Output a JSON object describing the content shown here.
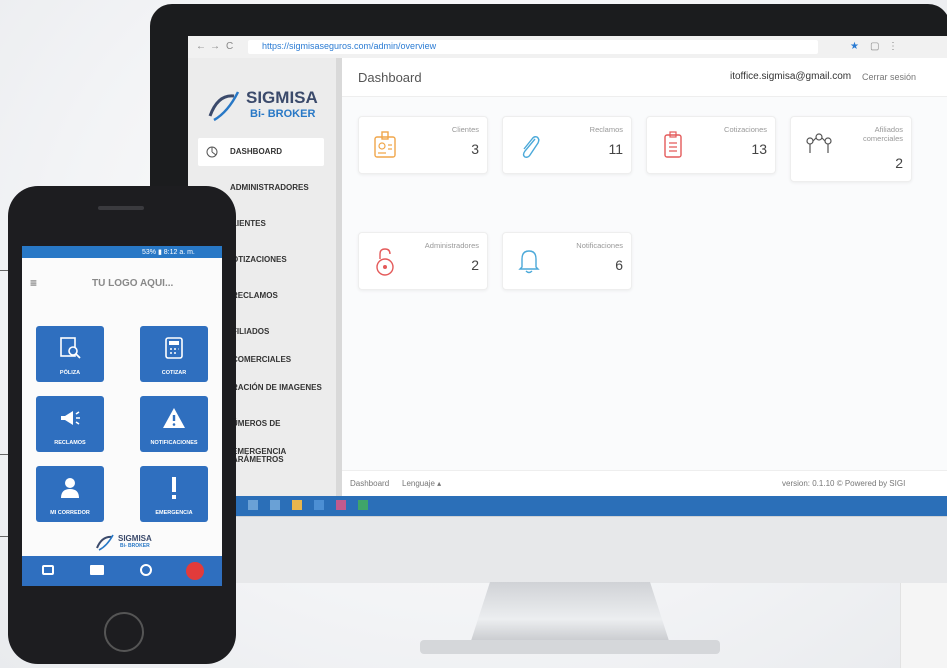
{
  "browser": {
    "url": "https://sigmisaseguros.com/admin/overview"
  },
  "brand": {
    "name": "SIGMISA",
    "tagline": "Bi- BROKER",
    "accent": "#2878c6"
  },
  "sidebar": {
    "items": [
      {
        "label": "DASHBOARD",
        "icon": "pie-chart-icon"
      },
      {
        "label": "ADMINISTRADORES"
      },
      {
        "label": "LIENTES"
      },
      {
        "label": "OTIZACIONES"
      },
      {
        "label": "RECLAMOS"
      },
      {
        "label": "FILIADOS COMERCIALES"
      },
      {
        "label": "RACIÓN DE IMAGENES"
      },
      {
        "label": "ÚMEROS DE EMERGENCIA"
      },
      {
        "label": "ARÁMETROS"
      }
    ]
  },
  "header": {
    "title": "Dashboard",
    "email": "itoffice.sigmisa@gmail.com",
    "logout": "Cerrar sesión"
  },
  "cards": [
    {
      "label": "Clientes",
      "value": "3",
      "color": "#f0a64a",
      "icon": "id-badge-icon"
    },
    {
      "label": "Reclamos",
      "value": "11",
      "color": "#4ba9d9",
      "icon": "paperclip-icon"
    },
    {
      "label": "Cotizaciones",
      "value": "13",
      "color": "#e45a5a",
      "icon": "clipboard-icon"
    },
    {
      "label": "Afiliados comerciales",
      "value": "2",
      "color": "#555555",
      "icon": "network-icon"
    },
    {
      "label": "Administradores",
      "value": "2",
      "color": "#e45a5a",
      "icon": "lock-icon"
    },
    {
      "label": "Notificaciones",
      "value": "6",
      "color": "#4ba9d9",
      "icon": "bell-icon"
    }
  ],
  "footer": {
    "link1": "Dashboard",
    "link2": "Lenguaje ▴",
    "version": "version: 0.1.10 © Powered by SIGI"
  },
  "phone": {
    "status": "53% ▮ 8:12 a. m.",
    "logo_placeholder": "TU LOGO AQUI...",
    "tiles": [
      {
        "label": "PÓLIZA",
        "icon": "document-search-icon"
      },
      {
        "label": "COTIZAR",
        "icon": "calculator-icon"
      },
      {
        "label": "RECLAMOS",
        "icon": "megaphone-icon"
      },
      {
        "label": "NOTIFICACIONES",
        "icon": "warning-icon"
      },
      {
        "label": "MI CORREDOR",
        "icon": "person-icon"
      },
      {
        "label": "EMERGENCIA",
        "icon": "exclamation-icon"
      }
    ],
    "brand_name": "SIGMISA",
    "brand_tagline": "Bi- BROKER",
    "nav": [
      "chat-icon",
      "mail-icon",
      "location-icon",
      "power-icon"
    ]
  }
}
